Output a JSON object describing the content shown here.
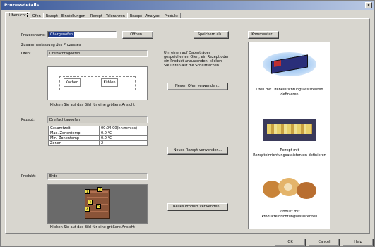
{
  "window": {
    "title": "Prozessdetails",
    "close_label": "×"
  },
  "tabs": [
    {
      "label": "Übersicht"
    },
    {
      "label": "Ofen"
    },
    {
      "label": "Rezept - Einstellungen"
    },
    {
      "label": "Rezept - Toleranzen"
    },
    {
      "label": "Rezept - Analyse"
    },
    {
      "label": "Produkt"
    }
  ],
  "process": {
    "name_label": "Prozessname:",
    "name_value": "Chargenofen",
    "open_button": "Öffnen...",
    "save_as_button": "Speichern als...",
    "comment_button": "Kommentar..."
  },
  "summary_label": "Zusammenfassung des Prozesses",
  "oven": {
    "label": "Ofen:",
    "value": "Dreifachtageofen",
    "zone_labels": [
      "Kochen",
      "Kühlen"
    ],
    "hint": "Klicken Sie auf das Bild für eine größere Ansicht",
    "new_button": "Neuen Ofen verwenden..."
  },
  "info_text": [
    "Um einen auf Datenträger",
    "gespeicherten Ofen, ein Rezept oder",
    "ein Produkt anzuwenden, klicken",
    "Sie unten auf die Schaltflächen."
  ],
  "recipe": {
    "label": "Rezept:",
    "value": "Dreifachtageofen",
    "params": [
      {
        "name": "Gesamtzeit",
        "value": "00:04:00(hh:mm:ss)"
      },
      {
        "name": "Max. Zonentemp",
        "value": "0.0 °C"
      },
      {
        "name": "Min. Zonentemp",
        "value": "0.0 °C"
      },
      {
        "name": "Zonen",
        "value": "2"
      }
    ],
    "new_button": "Neues Rezept verwenden..."
  },
  "product": {
    "label": "Produkt:",
    "value": "Erde",
    "marker_labels": [
      "1",
      "2",
      "3",
      "4",
      "5"
    ],
    "hint": "Klicken Sie auf das Bild für eine größere Ansicht",
    "new_button": "Neues Produkt verwenden..."
  },
  "right_panel": {
    "oven_caption": [
      "Ofen mit Ofeneinrichtungsassistenten",
      "definieren"
    ],
    "recipe_caption": [
      "Rezept mit",
      "Rezepteinrichtungsassistenten definieren"
    ],
    "product_caption": [
      "Produkt mit",
      "Produkteinrichtungsassistenten"
    ]
  },
  "footer": {
    "ok": "OK",
    "cancel": "Cancel",
    "help": "Help"
  },
  "colors": {
    "title_start": "#3c5a9a",
    "title_end": "#b8c8e4",
    "dialog_bg": "#d8d6cf",
    "selection": "#1e3a8c"
  }
}
